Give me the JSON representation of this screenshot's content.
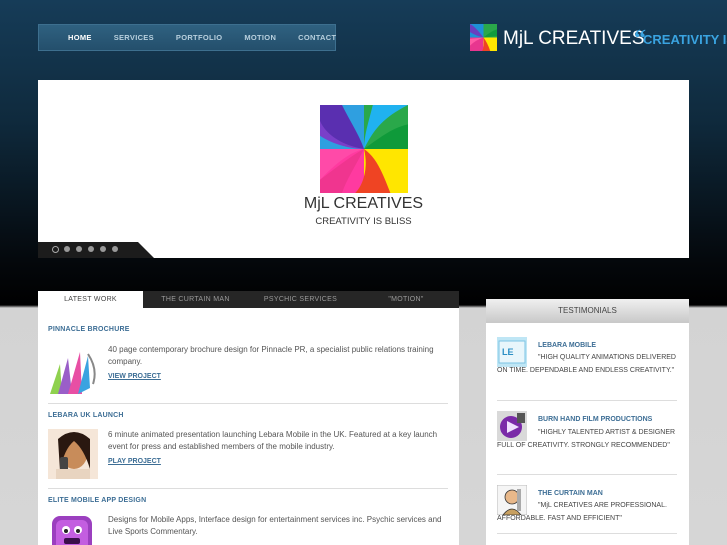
{
  "nav": {
    "items": [
      "HOME",
      "SERVICES",
      "PORTFOLIO",
      "MOTION",
      "CONTACT"
    ],
    "active": "HOME"
  },
  "header": {
    "brand": "MjL CREATIVES",
    "quote_mark": "“",
    "tagline": "CREATIVITY IS B"
  },
  "banner": {
    "brand": "MjL CREATIVES",
    "tagline": "CREATIVITY IS BLISS",
    "slide_count": 6,
    "active_slide": 1
  },
  "tabs": [
    "LATEST WORK",
    "THE CURTAIN MAN",
    "PSYCHIC SERVICES",
    "\"MOTION\""
  ],
  "projects": [
    {
      "title": "PINNACLE BROCHURE",
      "desc": "40 page contemporary brochure design for Pinnacle PR, a specialist public relations training company.",
      "link": "VIEW PROJECT"
    },
    {
      "title": "LEBARA UK LAUNCH",
      "desc": "6 minute animated presentation launching Lebara Mobile in the UK. Featured at a key launch event for press and established members of the mobile industry.",
      "link": "PLAY PROJECT"
    },
    {
      "title": "ELITE MOBILE APP DESIGN",
      "desc": "Designs for Mobile Apps, Interface design for entertainment services inc. Psychic services and Live Sports Commentary.",
      "link": ""
    }
  ],
  "testimonials": {
    "heading": "TESTIMONIALS",
    "items": [
      {
        "name": "LEBARA MOBILE",
        "quote": "\"HIGH QUALITY ANIMATIONS DELIVERED ON TIME. DEPENDABLE AND ENDLESS CREATIVITY.\""
      },
      {
        "name": "BURN HAND FILM PRODUCTIONS",
        "quote": "\"HIGHLY TALENTED ARTIST & DESIGNER FULL OF CREATIVITY. STRONGLY RECOMMENDED\""
      },
      {
        "name": "THE CURTAIN MAN",
        "quote": "\"MjL CREATIVES ARE PROFESSIONAL. AFFORDABLE. FAST AND EFFICIENT\""
      }
    ]
  }
}
